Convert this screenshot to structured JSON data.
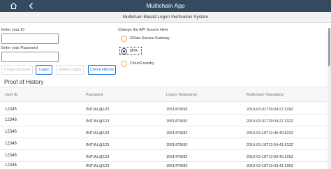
{
  "shell": {
    "title": "Multichain App",
    "home_icon": "home-icon",
    "back_icon": "back-arrow-icon"
  },
  "subheader": {
    "title": "Multichain Based Logon Verification System"
  },
  "form": {
    "id_label": "Enter your ID",
    "id_value": "",
    "password_label": "Enter your Password",
    "password_value": ""
  },
  "buttons": {
    "create_account": "Create Account",
    "logon": "Logon",
    "delete_logon": "Delete Logon",
    "check_history": "Check History"
  },
  "api_source": {
    "label": "Change the API Source Here",
    "options": [
      {
        "label": "OData Service Gateway",
        "selected": false
      },
      {
        "label": "MTA",
        "selected": true
      },
      {
        "label": "Cloud Foundry",
        "selected": false
      }
    ]
  },
  "history": {
    "title": "Proof of History",
    "columns": [
      "User ID",
      "Password",
      "Logon Timestamp",
      "Multichain Timestamp"
    ],
    "rows": [
      [
        "12345",
        "INITIAL@123",
        "1551470693",
        "2019-03-01T20:04:27.329Z"
      ],
      [
        "12346",
        "INITIAL@123",
        "1551470682",
        "2019-03-01T20:04:27.332Z"
      ],
      [
        "12346",
        "INITIAL@123",
        "1551470682",
        "2019-03-18T12:46:40.822Z"
      ],
      [
        "12346",
        "INITIAL@123",
        "1551470682",
        "2019-03-18T12:54:41.812Z"
      ],
      [
        "12346",
        "INITIAL@123",
        "1551470682",
        "2019-03-18T13:00:40.225Z"
      ],
      [
        "12346",
        "INITIAL@123",
        "1551470682",
        "2019-03-18T13:03:41.336Z"
      ]
    ]
  },
  "colors": {
    "shell_bg": "#354a5f",
    "accent": "#0a6ed1",
    "radio_border": "#e5a83b"
  }
}
